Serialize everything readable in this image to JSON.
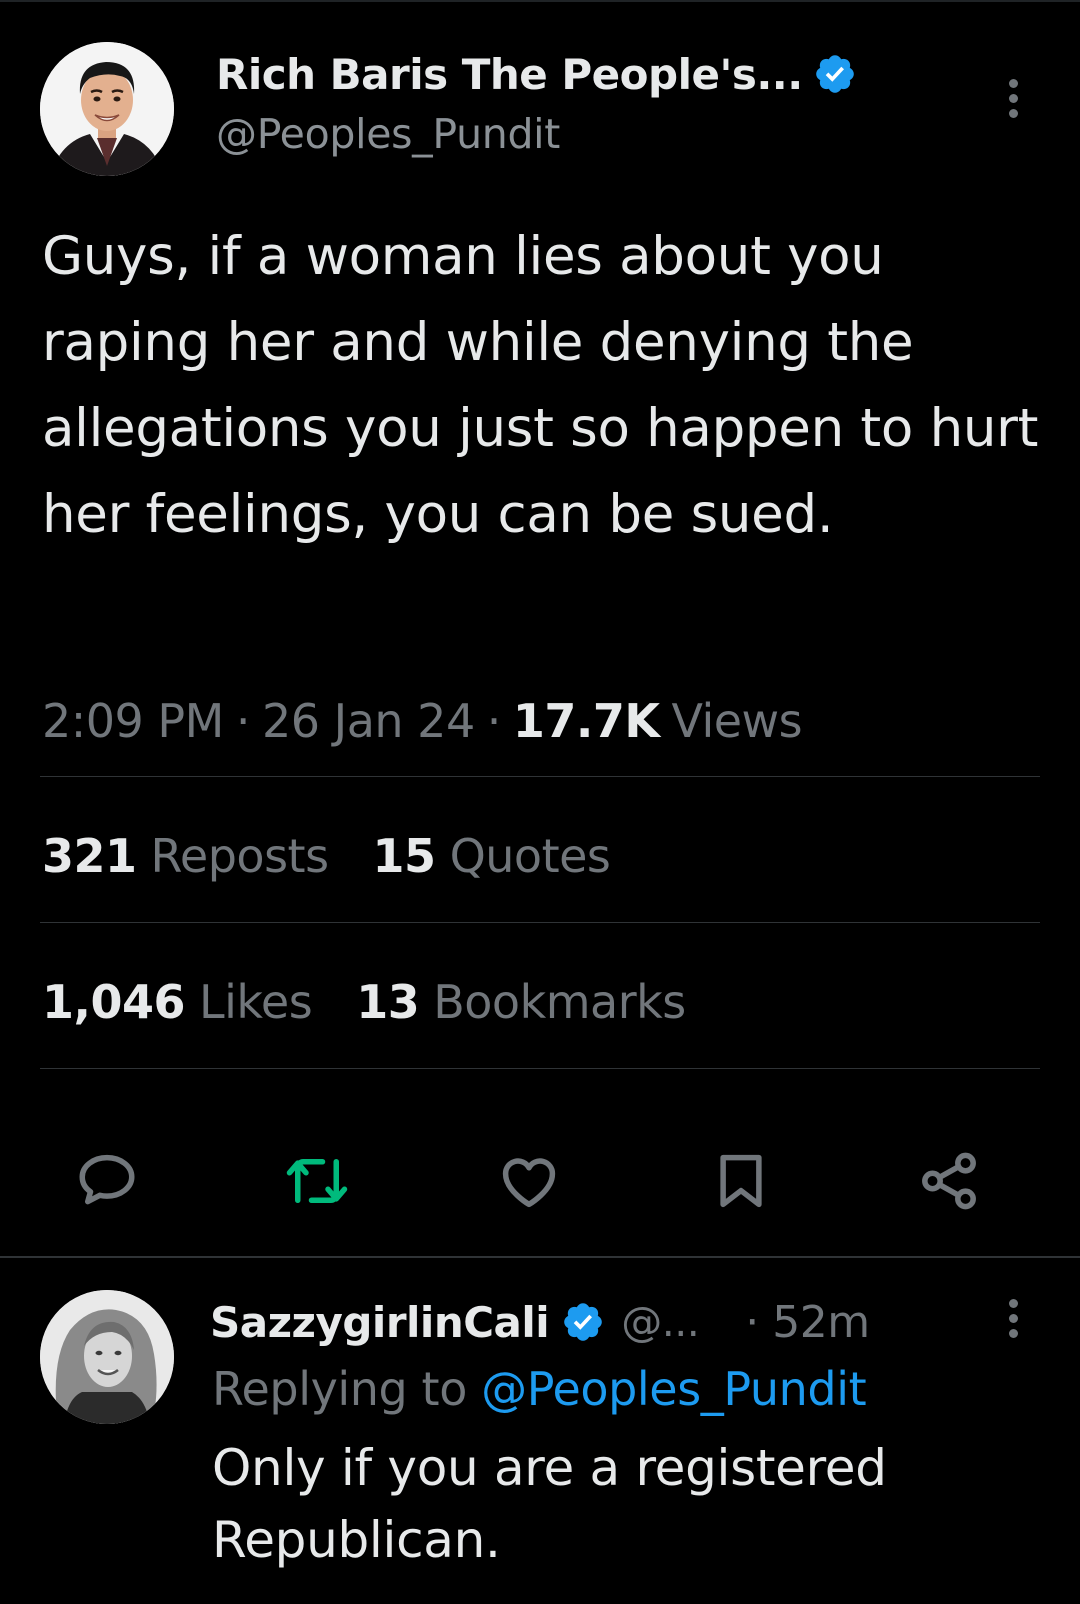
{
  "tweet": {
    "display_name": "Rich Baris The People's...",
    "handle": "@Peoples_Pundit",
    "text": "Guys, if a woman lies about you raping her and while denying the allegations you just so happen to hurt her feelings, you can be sued.",
    "time": "2:09 PM",
    "date": "26 Jan 24",
    "views_count": "17.7K",
    "views_label": "Views",
    "separator": "·",
    "reposts_count": "321",
    "reposts_label": "Reposts",
    "quotes_count": "15",
    "quotes_label": "Quotes",
    "likes_count": "1,046",
    "likes_label": "Likes",
    "bookmarks_count": "13",
    "bookmarks_label": "Bookmarks",
    "actions": [
      "reply-icon",
      "repost-icon",
      "like-icon",
      "bookmark-icon",
      "share-icon"
    ]
  },
  "reply": {
    "display_name": "SazzygirlinCali",
    "handle": "@...",
    "time": "· 52m",
    "replying_to_label": "Replying to",
    "replying_to_handle": "@Peoples_Pundit",
    "text": "Only if you are a registered Republican."
  },
  "colors": {
    "background": "#000000",
    "text_primary": "#e7e9ea",
    "text_secondary": "#71767b",
    "verified": "#1d9bf0",
    "repost_active": "#00ba7c",
    "divider": "#2f3336"
  }
}
